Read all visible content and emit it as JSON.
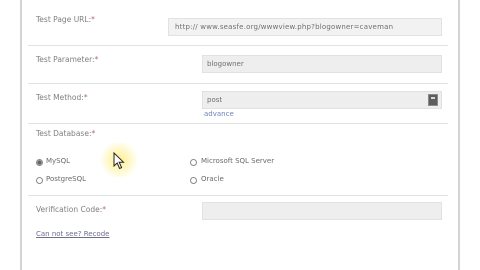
{
  "form": {
    "test_page_url": {
      "label": "Test Page URL:",
      "required_mark": "*",
      "value": "http:// www.seasfe.org/wwwview.php?blogowner=caveman"
    },
    "test_parameter": {
      "label": "Test Parameter:",
      "required_mark": "*",
      "value": "blogowner"
    },
    "test_method": {
      "label": "Test Method:",
      "required_mark": "*",
      "value": "post",
      "advance_link": "advance"
    },
    "test_database": {
      "label": "Test Database:",
      "required_mark": "*",
      "options": [
        {
          "label": "MySQL",
          "selected": true
        },
        {
          "label": "Microsoft SQL Server",
          "selected": false
        },
        {
          "label": "PostgreSQL",
          "selected": false
        },
        {
          "label": "Oracle",
          "selected": false
        }
      ]
    },
    "verification_code": {
      "label": "Verification Code:",
      "required_mark": "*",
      "value": ""
    },
    "cant_see_link": "Can not see? Recode"
  },
  "colors": {
    "label_text": "#7f7f7f",
    "field_bg": "#eeeeee",
    "link": "#6c84b8",
    "cursor_highlight": "#ffec78"
  },
  "icons": {
    "select_dropdown": "dropdown-icon",
    "mouse_pointer": "pointer-icon"
  }
}
